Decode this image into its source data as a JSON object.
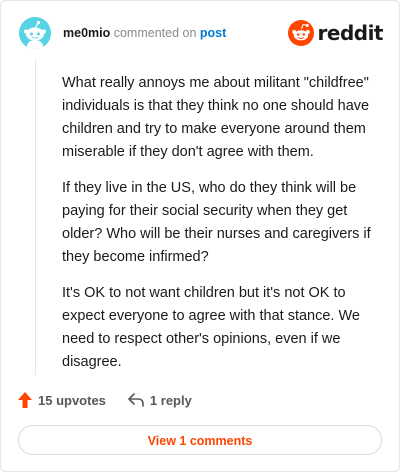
{
  "header": {
    "username": "me0mio",
    "commented_on": "commented on",
    "post_link": "post",
    "logo_text": "reddit",
    "avatar_color": "#57d3e6",
    "logo_color": "#ff4500"
  },
  "comment": {
    "paragraphs": [
      "What really annoys me about militant \"childfree\" individuals is that they think no one should have children and try to make everyone around them miserable if they don't agree with them.",
      "If they live in the US, who do they think will be paying for their social security when they get older? Who will be their nurses and caregivers if they become infirmed?",
      "It's OK to not want children but it's not OK to expect everyone to agree with that stance. We need to respect other's opinions, even if we disagree."
    ]
  },
  "actions": {
    "upvotes_label": "15 upvotes",
    "replies_label": "1 reply",
    "upvote_icon": "upvote-arrow-icon",
    "reply_icon": "reply-arrow-icon"
  },
  "footer": {
    "view_comments_label": "View 1 comments",
    "accent_color": "#ff4500"
  }
}
